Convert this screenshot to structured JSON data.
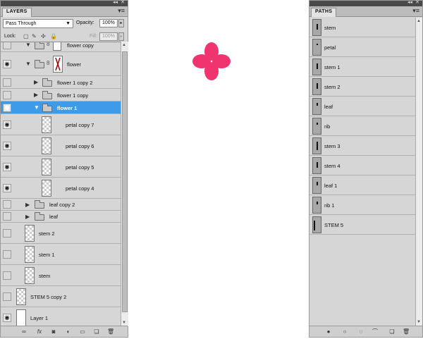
{
  "layers_panel": {
    "tab_label": "LAYERS",
    "blend_mode": "Pass Through",
    "opacity_label": "Opacity:",
    "opacity_value": "100%",
    "lock_label": "Lock:",
    "fill_label": "Fill:",
    "fill_value": "100%",
    "layers": [
      {
        "name": "flower copy",
        "type": "group",
        "visible": false,
        "expanded": true
      },
      {
        "name": "flower",
        "type": "group",
        "visible": true,
        "expanded": true
      },
      {
        "name": "flower 1 copy 2",
        "type": "group",
        "visible": false,
        "expanded": false
      },
      {
        "name": "flower 1 copy",
        "type": "group",
        "visible": false,
        "expanded": false
      },
      {
        "name": "flower 1",
        "type": "group",
        "visible": true,
        "expanded": true,
        "selected": true
      },
      {
        "name": "petal copy 7",
        "type": "layer",
        "visible": true
      },
      {
        "name": "petal copy 6",
        "type": "layer",
        "visible": true
      },
      {
        "name": "petal copy 5",
        "type": "layer",
        "visible": true
      },
      {
        "name": "petal copy 4",
        "type": "layer",
        "visible": true
      },
      {
        "name": "leaf copy 2",
        "type": "group",
        "visible": false,
        "expanded": false
      },
      {
        "name": "leaf",
        "type": "group",
        "visible": false,
        "expanded": false
      },
      {
        "name": "stem 2",
        "type": "layer",
        "visible": false
      },
      {
        "name": "stem 1",
        "type": "layer",
        "visible": false
      },
      {
        "name": "stem",
        "type": "layer",
        "visible": false
      },
      {
        "name": "STEM 5 copy 2",
        "type": "layer",
        "visible": false
      },
      {
        "name": "Layer 1",
        "type": "layer",
        "visible": true
      }
    ]
  },
  "paths_panel": {
    "tab_label": "PATHS",
    "paths": [
      "stem",
      "petal",
      "stem 1",
      "stem 2",
      "leaf",
      "rib",
      "stem 3",
      "stem 4",
      "leaf 1",
      "rib 1",
      "STEM 5"
    ]
  },
  "icons": {
    "eye": "eye-icon",
    "link": "link-icon",
    "fx": "fx-icon",
    "mask": "add-mask-icon",
    "adjustment": "adjustment-layer-icon",
    "new_group": "new-group-icon",
    "new_layer": "new-layer-icon",
    "trash": "trash-icon"
  },
  "colors": {
    "selection": "#3d9be9",
    "flower": "#ef3470",
    "panel_bg": "#d6d6d6"
  }
}
